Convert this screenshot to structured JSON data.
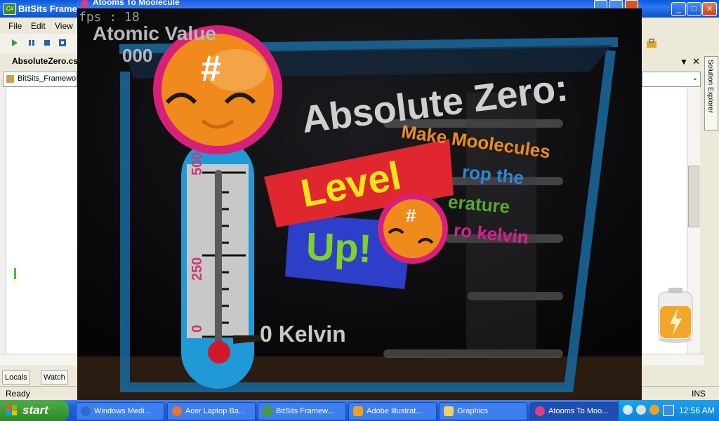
{
  "ide": {
    "title": "BitSits Frame",
    "menu": [
      "File",
      "Edit",
      "View"
    ],
    "tab": "AbsoluteZero.cs",
    "combo": "BitSits_Framewor",
    "bottom_tabs": [
      "Locals",
      "Watch"
    ],
    "status": "Ready",
    "ins": "INS",
    "solution_explorer": "Solution Explorer"
  },
  "game_window": {
    "title": "Atooms To Moolecule"
  },
  "game": {
    "fps": "fps : 18",
    "atomic_label": "Atomic Value",
    "atomic_value": "000",
    "title": "Absolute Zero:",
    "instructions": [
      "Make Moolecules",
      "rop the",
      "erature",
      "ro kelvin"
    ],
    "level_up_line1": "Level",
    "level_up_line2": "Up!",
    "kelvin_label": "0 Kelvin",
    "thermo_ticks": [
      "500",
      "250",
      "0"
    ],
    "hash": "#"
  },
  "taskbar": {
    "start": "start",
    "items": [
      {
        "label": "Windows Medi...",
        "icon_color": "#2b6bd6"
      },
      {
        "label": "Acer Laptop Ba...",
        "icon_color": "#e7762a"
      },
      {
        "label": "BitSits Framew...",
        "icon_color": "#4a9a3a"
      },
      {
        "label": "Adobe Illustrat...",
        "icon_color": "#f0a020"
      },
      {
        "label": "Graphics",
        "icon_color": "#f2d060"
      },
      {
        "label": "Atooms To Moo...",
        "icon_color": "#e03a8a"
      }
    ],
    "clock": "12:56 AM"
  },
  "colors": {
    "thermo_blue": "#1f9ad6",
    "face_orange": "#f08a1c",
    "face_ring": "#d8207a",
    "level_red": "#e0262e",
    "level_yellow": "#f7e41a",
    "up_blue": "#2d3ec8",
    "up_green": "#7fd02a",
    "instr_orange": "#e88b26",
    "instr_blue": "#2f86d6",
    "instr_green": "#5aa82e",
    "instr_pink": "#d8208a"
  }
}
